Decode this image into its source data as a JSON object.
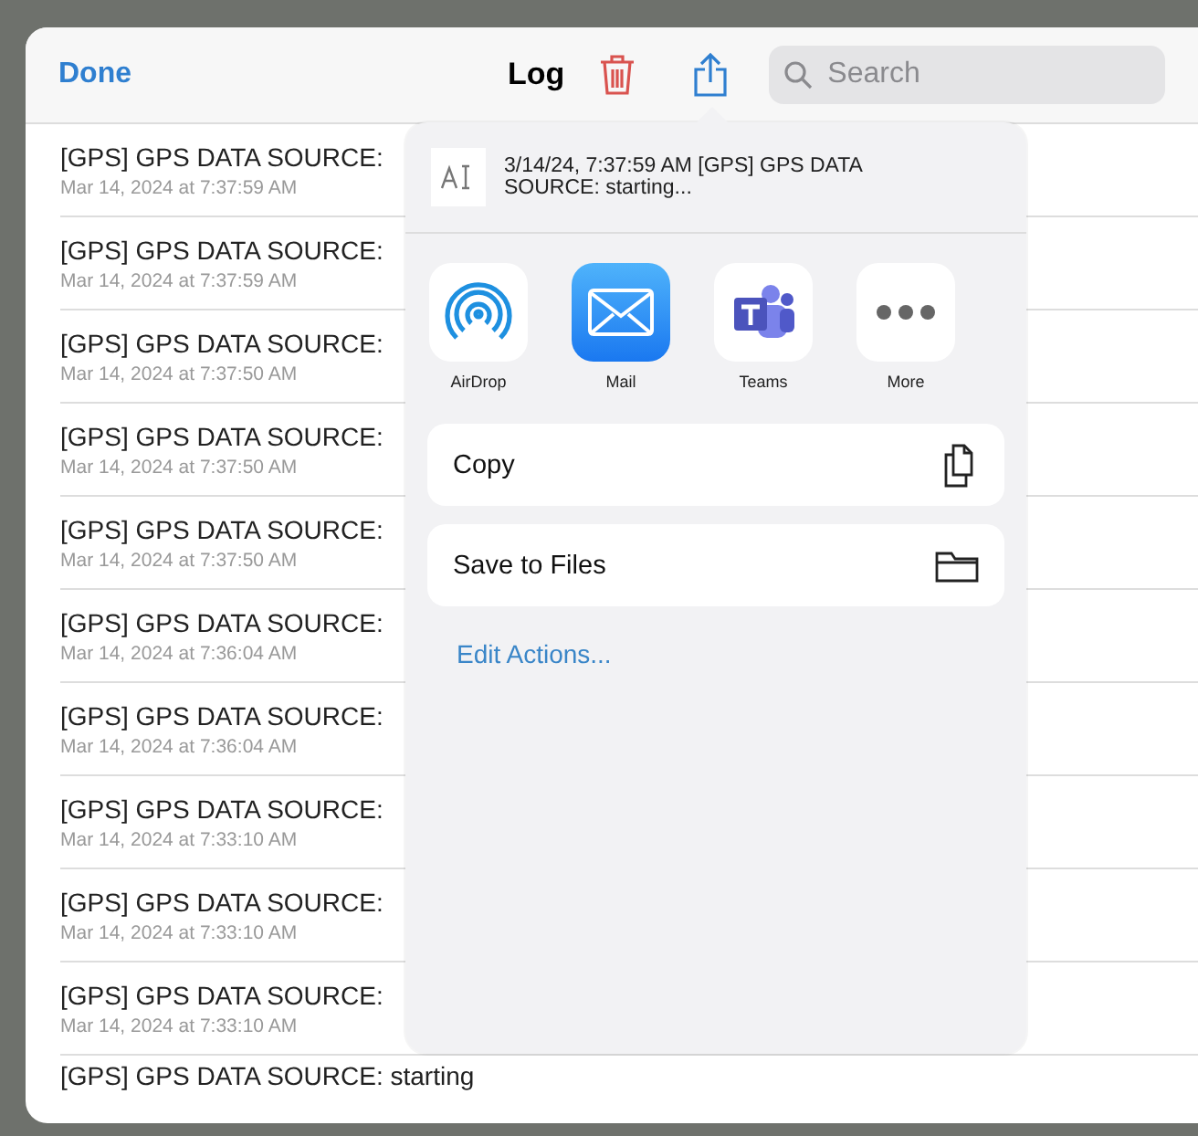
{
  "header": {
    "done": "Done",
    "title": "Log",
    "search": {
      "placeholder": "Search"
    }
  },
  "rows": [
    {
      "title": "[GPS] GPS DATA SOURCE:",
      "date": "Mar 14, 2024 at 7:37:59 AM"
    },
    {
      "title": "[GPS] GPS DATA SOURCE:",
      "date": "Mar 14, 2024 at 7:37:59 AM"
    },
    {
      "title": "[GPS] GPS DATA SOURCE:",
      "date": "Mar 14, 2024 at 7:37:50 AM"
    },
    {
      "title": "[GPS] GPS DATA SOURCE:",
      "date": "Mar 14, 2024 at 7:37:50 AM"
    },
    {
      "title": "[GPS] GPS DATA SOURCE:",
      "date": "Mar 14, 2024 at 7:37:50 AM"
    },
    {
      "title": "[GPS] GPS DATA SOURCE:",
      "date": "Mar 14, 2024 at 7:36:04 AM"
    },
    {
      "title": "[GPS] GPS DATA SOURCE:",
      "date": "Mar 14, 2024 at 7:36:04 AM"
    },
    {
      "title": "[GPS] GPS DATA SOURCE:",
      "date": "Mar 14, 2024 at 7:33:10 AM"
    },
    {
      "title": "[GPS] GPS DATA SOURCE:",
      "date": "Mar 14, 2024 at 7:33:10 AM"
    },
    {
      "title": "[GPS] GPS DATA SOURCE:",
      "date": "Mar 14, 2024 at 7:33:10 AM"
    },
    {
      "title": "[GPS] GPS DATA SOURCE: starting"
    }
  ],
  "share": {
    "preview": "3/14/24, 7:37:59 AM [GPS] GPS DATA SOURCE: starting...",
    "apps": [
      {
        "kind": "airdrop",
        "label": "AirDrop"
      },
      {
        "kind": "mail",
        "label": "Mail"
      },
      {
        "kind": "teams",
        "label": "Teams"
      },
      {
        "kind": "more",
        "label": "More"
      }
    ],
    "actions": [
      {
        "kind": "copy",
        "label": "Copy"
      },
      {
        "kind": "files",
        "label": "Save to Files"
      }
    ],
    "edit": "Edit Actions..."
  }
}
